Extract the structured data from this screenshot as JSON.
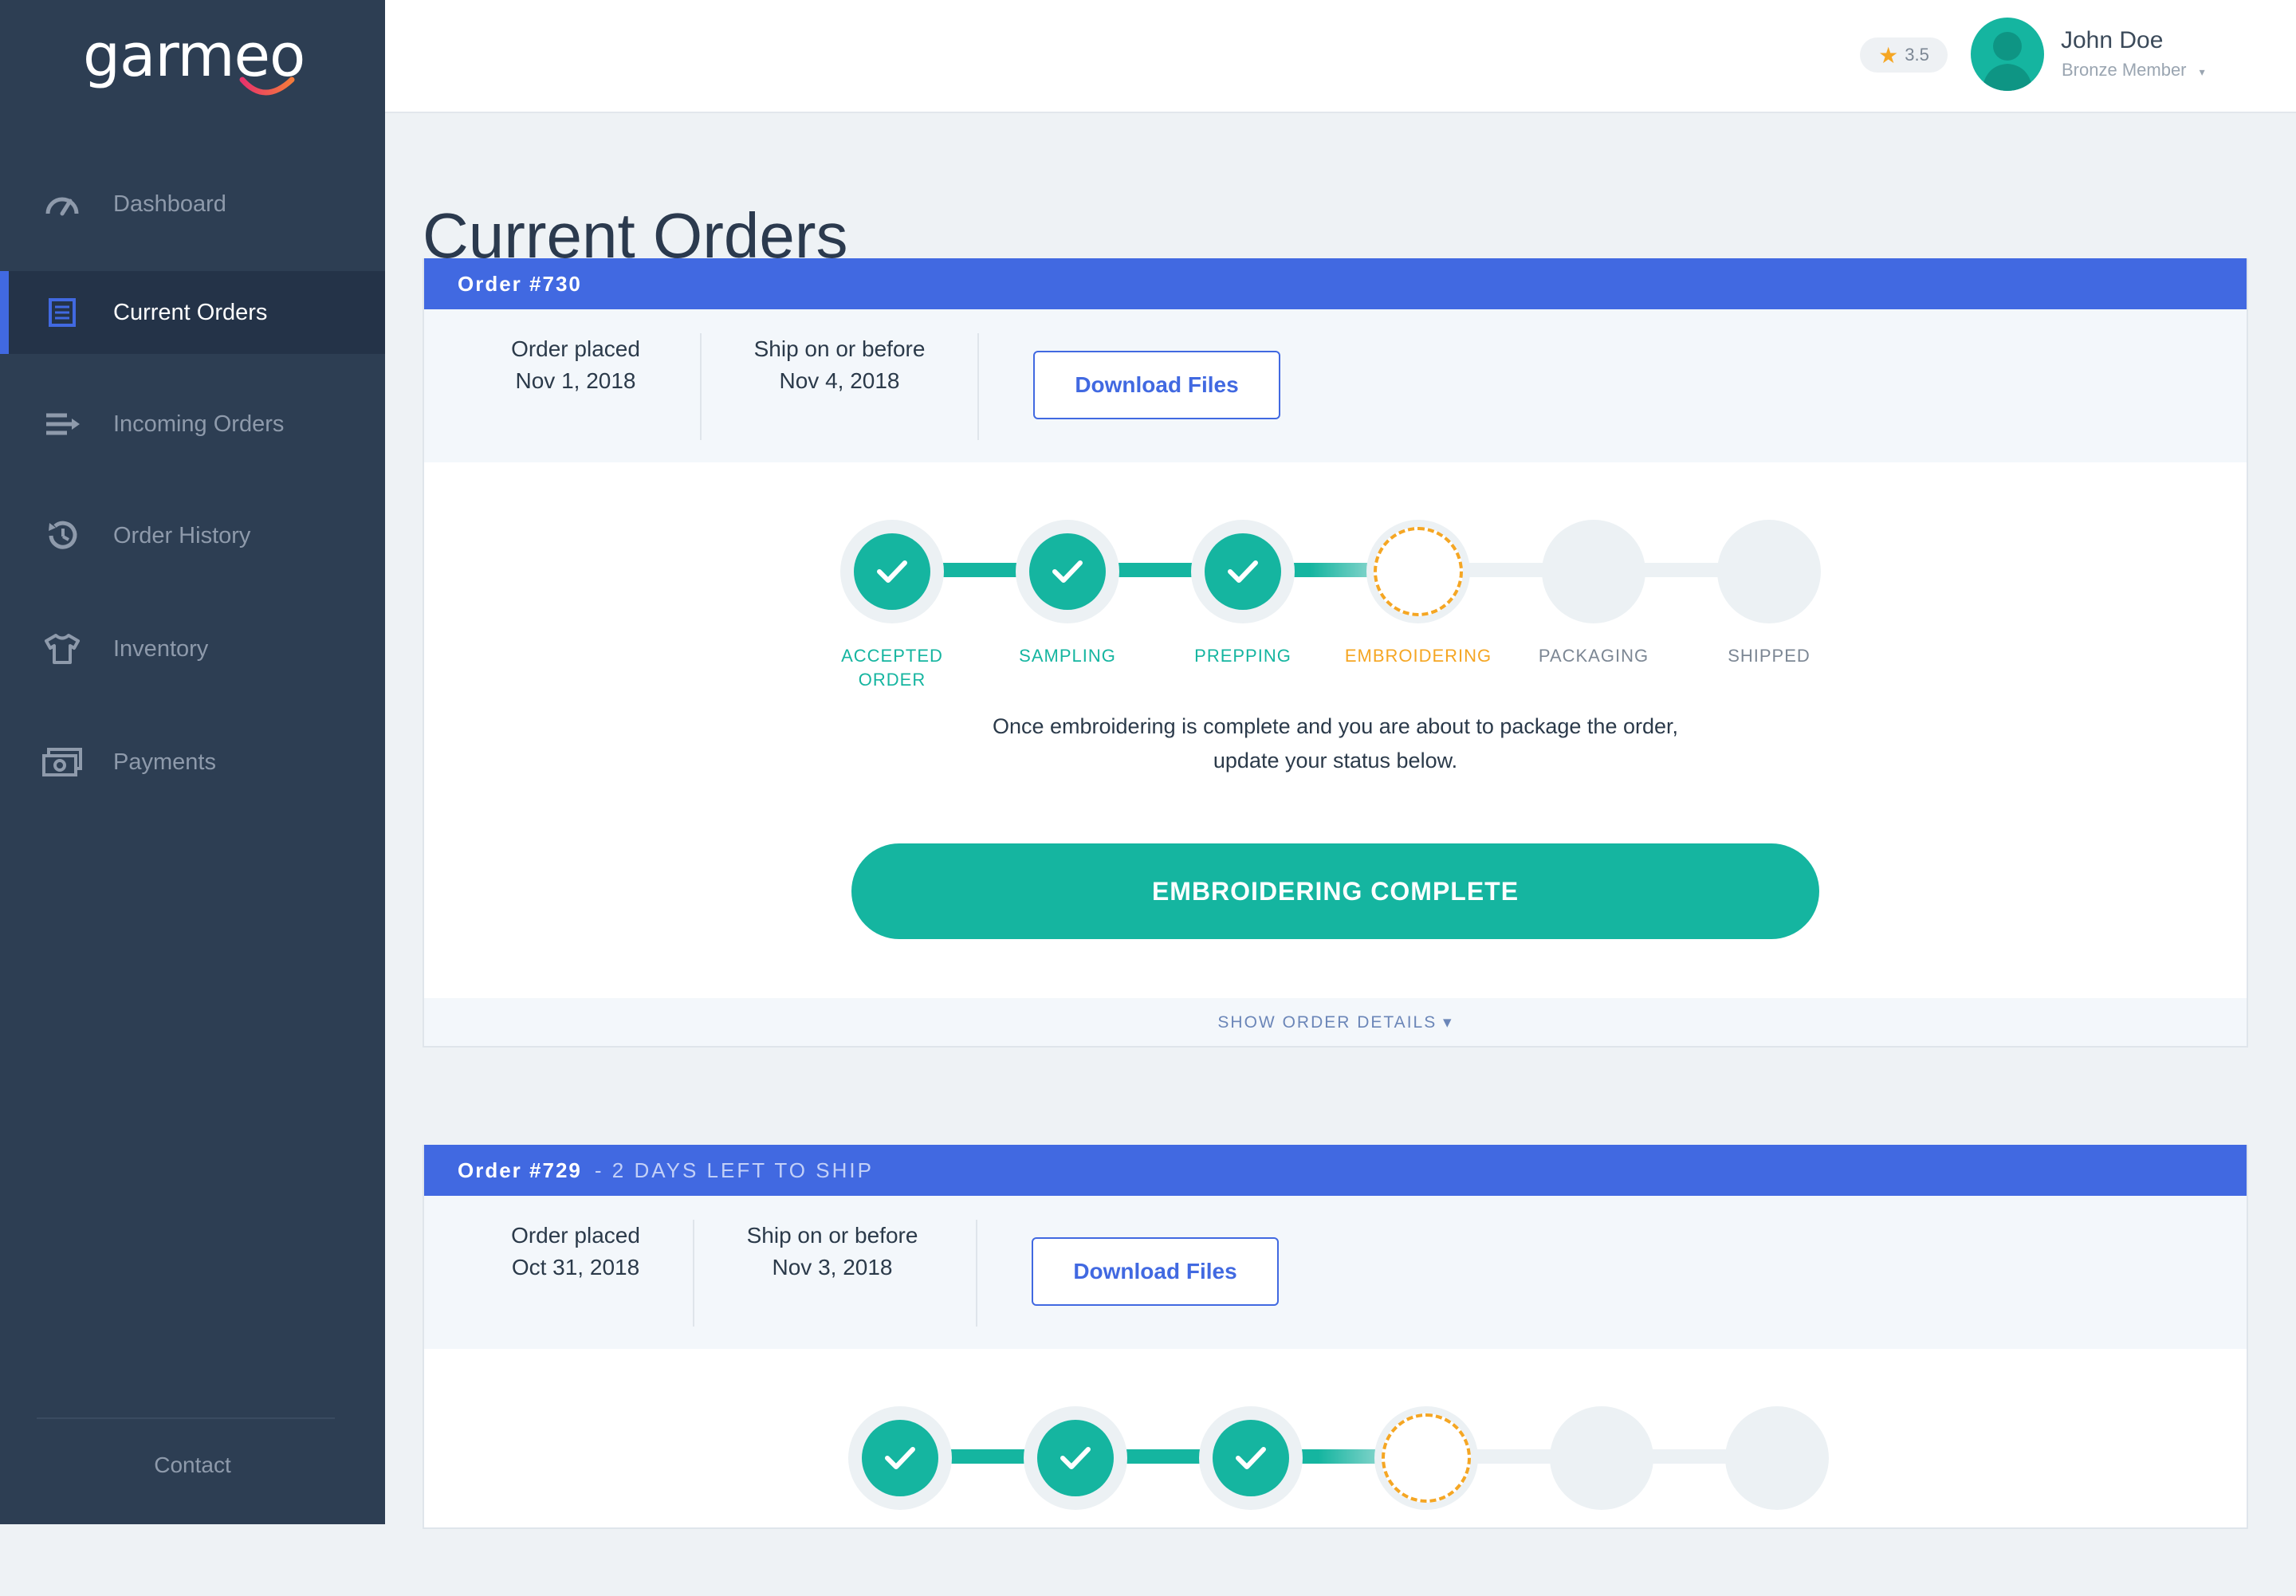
{
  "app": {
    "logo": "garmeo"
  },
  "sidebar": {
    "items": [
      {
        "label": "Dashboard",
        "icon": "speedometer-icon"
      },
      {
        "label": "Current Orders",
        "icon": "list-icon",
        "active": true
      },
      {
        "label": "Incoming Orders",
        "icon": "incoming-icon"
      },
      {
        "label": "Order History",
        "icon": "history-icon"
      },
      {
        "label": "Inventory",
        "icon": "shirt-icon"
      },
      {
        "label": "Payments",
        "icon": "cash-icon"
      }
    ],
    "contact": "Contact"
  },
  "header": {
    "rating": "3.5",
    "user_name": "John Doe",
    "user_level": "Bronze Member"
  },
  "page_title": "Current Orders",
  "orders": [
    {
      "title": "Order #730",
      "subtitle": "",
      "placed_label": "Order placed",
      "placed_date": "Nov 1, 2018",
      "ship_label": "Ship on or before",
      "ship_date": "Nov 4, 2018",
      "download_label": "Download Files",
      "steps": [
        {
          "label": "ACCEPTED ORDER",
          "state": "done"
        },
        {
          "label": "SAMPLING",
          "state": "done"
        },
        {
          "label": "PREPPING",
          "state": "done"
        },
        {
          "label": "EMBROIDERING",
          "state": "current"
        },
        {
          "label": "PACKAGING",
          "state": "pending"
        },
        {
          "label": "SHIPPED",
          "state": "pending"
        }
      ],
      "status_line1": "Once embroidering is complete and you are about to package the order,",
      "status_line2": "update your status below.",
      "action_label": "EMBROIDERING COMPLETE",
      "details_label": "SHOW ORDER DETAILS ▾"
    },
    {
      "title": "Order #729",
      "subtitle": "- 2 DAYS LEFT TO SHIP",
      "placed_label": "Order placed",
      "placed_date": "Oct 31, 2018",
      "ship_label": "Ship on or before",
      "ship_date": "Nov 3, 2018",
      "download_label": "Download Files"
    }
  ],
  "colors": {
    "sidebar": "#2d3e53",
    "accent_blue": "#4169e1",
    "teal": "#15b5a0",
    "orange": "#f5a623"
  }
}
